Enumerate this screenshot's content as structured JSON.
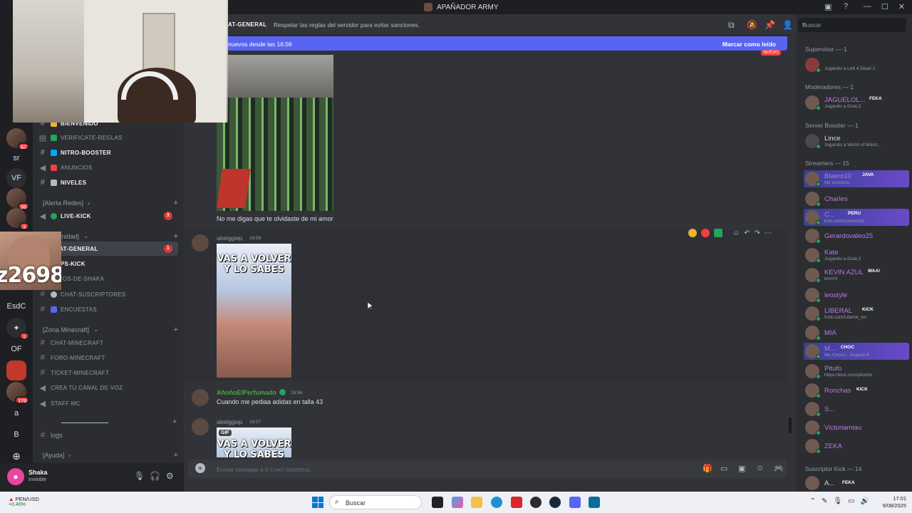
{
  "window": {
    "title": "APAÑADOR ARMY",
    "controls": [
      "—",
      "☐",
      "✕"
    ]
  },
  "servers": [
    {
      "label": "",
      "badge": "67"
    },
    {
      "label": "sr",
      "badge": ""
    },
    {
      "label": "VF",
      "badge": ""
    },
    {
      "label": "",
      "badge": "96"
    },
    {
      "label": "",
      "badge": "3"
    },
    {
      "label": "EsdC",
      "badge": ""
    },
    {
      "label": "",
      "badge": "1"
    },
    {
      "label": "OF",
      "badge": ""
    },
    {
      "label": "",
      "badge": ""
    },
    {
      "label": "",
      "badge": "176"
    },
    {
      "label": "a",
      "badge": ""
    },
    {
      "label": "B",
      "badge": ""
    }
  ],
  "webcam_overlay_text": "z2698",
  "channels": {
    "items": [
      {
        "name": "BIENVENIDO",
        "bold": true
      },
      {
        "name": "VERIFICATE-REGLAS",
        "bold": false
      },
      {
        "name": "NITRO-BOOSTER",
        "bold": true
      },
      {
        "name": "ANUNCIOS",
        "bold": false
      },
      {
        "name": "NIVELES",
        "bold": true
      }
    ],
    "cat_alerta": "[Alerta Redes]",
    "live_kick": "LIVE-KICK",
    "live_kick_badge": "3",
    "cat_comunidad": "[Comunidad]",
    "comunidad": [
      {
        "name": "CHAT-GENERAL",
        "badge": "1"
      },
      {
        "name": "CLIPS-KICK",
        "badge": ""
      },
      {
        "name": "FOTOS-DE-SHAKA",
        "badge": ""
      },
      {
        "name": "CHAT-SUSCRIPTORES",
        "badge": ""
      },
      {
        "name": "ENCUESTAS",
        "badge": ""
      }
    ],
    "cat_minecraft": "[Zona Minecraft]",
    "minecraft": [
      "CHAT-MINECRAFT",
      "FORO-MINECRAFT",
      "TICKET-MINECRAFT",
      "CREA TU CANAL DE VOZ",
      "STAFF MC"
    ],
    "logs": "logs",
    "cat_ayuda": "[Ayuda]"
  },
  "user": {
    "name": "Shaka",
    "status": "Invisible"
  },
  "header": {
    "channel": "AT-GENERAL",
    "topic": "Respetar las reglas del servidor para evitar sanciones."
  },
  "newbar": {
    "left": "nuevos desde las 16:56",
    "right": "Marcar como leído"
  },
  "new_tag": "NUEVO",
  "messages": {
    "m1_text": "No me digas que te olvidaste de mi amor",
    "m2_author": "abelggwp",
    "m2_time": "16:56",
    "m2_caption": "VAS A VOLVER Y LO SABES",
    "m3_author": "AñoñoElPerfumado",
    "m3_time": "16:56",
    "m3_text": "Cuando me pediaa adidas en talla 43",
    "m4_author": "abelggwp",
    "m4_time": "16:57",
    "m4_gif": "GIF",
    "m4_caption": "VAS A VOLVER Y LO SABES"
  },
  "composer": {
    "placeholder": "Enviar mensaje a #",
    "channel": "CHAT-GENERAL"
  },
  "search": {
    "placeholder": "Buscar"
  },
  "members": {
    "groups": [
      {
        "label": "Supervisor — 1"
      },
      {
        "label": "Moderadores — 1"
      },
      {
        "label": "Server Booster — 1"
      },
      {
        "label": "Streamers — 15"
      },
      {
        "label": "Suscriptor Kick — 14"
      }
    ],
    "list": [
      {
        "name": "",
        "activity": "Jugando a Left 4 Dead 2",
        "tag": "",
        "color": "#f23f43"
      },
      {
        "name": "JAGUELOL...",
        "activity": "Jugando a Dota 2",
        "tag": "FEKA",
        "color": "#b97be0"
      },
      {
        "name": "Lince",
        "activity": "Jugando a World of Warcr...",
        "tag": "",
        "color": "#dbdee1"
      },
      {
        "name": "Blaero10",
        "activity": "My princess",
        "tag": "JAVA",
        "color": "#b97be0"
      },
      {
        "name": "Charles",
        "activity": "",
        "tag": "",
        "color": "#b97be0"
      },
      {
        "name": "C...",
        "activity": "kick.com/cosmecito",
        "tag": "PERU",
        "color": "#b97be0"
      },
      {
        "name": "Gerardovaleo25",
        "activity": "",
        "tag": "",
        "color": "#b97be0"
      },
      {
        "name": "Kate",
        "activity": "Jugando a Dota 2",
        "tag": "",
        "color": "#b97be0"
      },
      {
        "name": "KEVIN AZUL",
        "activity": "brrrrrrr",
        "tag": "WAA!",
        "color": "#b97be0"
      },
      {
        "name": "leostyle",
        "activity": "",
        "tag": "",
        "color": "#b97be0"
      },
      {
        "name": "LIBERAL",
        "activity": "Kick.com/Liberal_ws",
        "tag": "KICK",
        "color": "#b97be0"
      },
      {
        "name": "MIA",
        "activity": "",
        "tag": "",
        "color": "#b97be0"
      },
      {
        "name": "M...",
        "activity": "Mu Choco - Season 6",
        "tag": "CHOC",
        "color": "#b97be0"
      },
      {
        "name": "Pitufo",
        "activity": "https://kick.com/pitufotv",
        "tag": "",
        "color": "#b97be0"
      },
      {
        "name": "Ronchas",
        "activity": "",
        "tag": "KICK",
        "color": "#b97be0"
      },
      {
        "name": "S...",
        "activity": "",
        "tag": "",
        "color": "#b97be0"
      },
      {
        "name": "Victoriamiau",
        "activity": "",
        "tag": "",
        "color": "#b97be0"
      },
      {
        "name": "ZEKA",
        "activity": "",
        "tag": "",
        "color": "#b97be0"
      },
      {
        "name": "A...",
        "activity": "",
        "tag": "FEKA",
        "color": "#dbdee1"
      }
    ]
  },
  "taskbar": {
    "weather_title": "PEN/USD",
    "weather_sub": "+0.46%",
    "search": "Buscar",
    "time": "17:01",
    "date": "9/08/2025"
  }
}
